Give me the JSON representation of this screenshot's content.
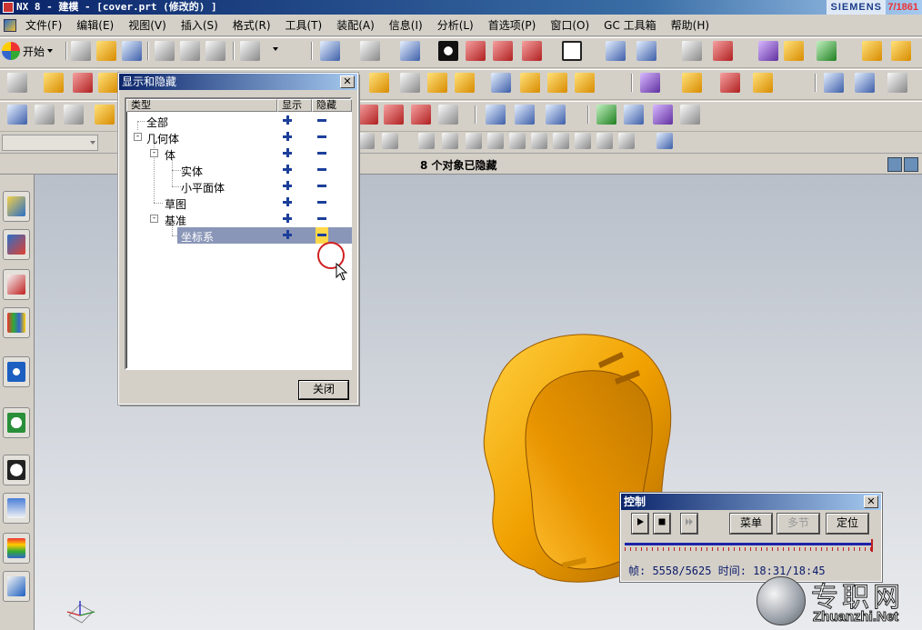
{
  "window": {
    "title": "NX 8 - 建模 - [cover.prt (修改的) ]",
    "brand": "SIEMENS",
    "brand_suffix": "7/1861"
  },
  "menu": [
    "文件(F)",
    "编辑(E)",
    "视图(V)",
    "插入(S)",
    "格式(R)",
    "工具(T)",
    "装配(A)",
    "信息(I)",
    "分析(L)",
    "首选项(P)",
    "窗口(O)",
    "GC 工具箱",
    "帮助(H)"
  ],
  "toolbar": {
    "start_label": "开始"
  },
  "status": {
    "message": "8 个对象已隐藏"
  },
  "show_hide_dialog": {
    "title": "显示和隐藏",
    "columns": {
      "type": "类型",
      "show": "显示",
      "hide": "隐藏"
    },
    "rows": [
      {
        "label": "全部"
      },
      {
        "label": "几何体"
      },
      {
        "label": "体"
      },
      {
        "label": "实体"
      },
      {
        "label": "小平面体"
      },
      {
        "label": "草图"
      },
      {
        "label": "基准"
      },
      {
        "label": "坐标系"
      }
    ],
    "close_label": "关闭",
    "selected_row": "坐标系"
  },
  "control_dialog": {
    "title": "控制",
    "menu_label": "菜单",
    "steps_label": "多节",
    "locate_label": "定位",
    "frame_label": "帧: 5558/5625",
    "time_label": "时间: 18:31/18:45",
    "frame_current": 5558,
    "frame_total": 5625
  },
  "watermark": {
    "cn": "专职网",
    "en": "Zhuanzhi.Net"
  },
  "colors": {
    "part": "#f0a000",
    "title_active": "#0a246a",
    "icon_blue": "#1c3f9a"
  }
}
